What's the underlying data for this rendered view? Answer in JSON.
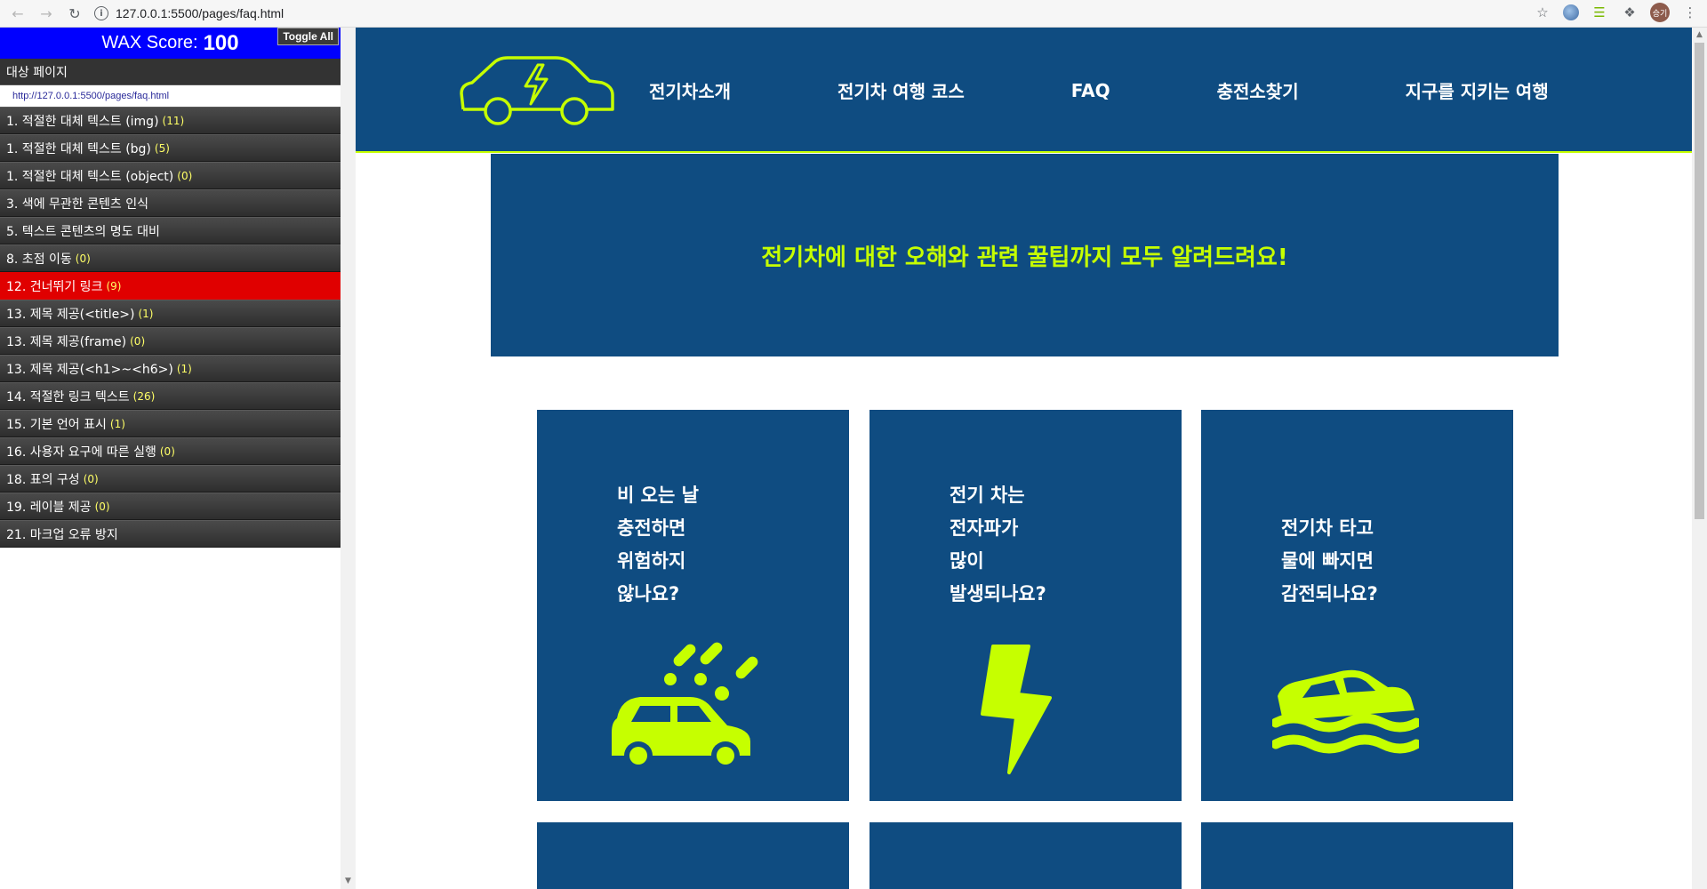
{
  "browser": {
    "url": "127.0.0.1:5500/pages/faq.html",
    "profile_label": "승기"
  },
  "wax": {
    "score_label": "WAX Score:",
    "score_value": "100",
    "toggle_all": "Toggle All",
    "target_label": "대상 페이지",
    "target_url": "http://127.0.0.1:5500/pages/faq.html",
    "items": [
      {
        "label": "1. 적절한 대체 텍스트 (img)",
        "count": "(11)"
      },
      {
        "label": "1. 적절한 대체 텍스트 (bg)",
        "count": "(5)"
      },
      {
        "label": "1. 적절한 대체 텍스트 (object)",
        "count": "(0)"
      },
      {
        "label": "3. 색에 무관한 콘텐츠 인식",
        "count": ""
      },
      {
        "label": "5. 텍스트 콘텐츠의 명도 대비",
        "count": ""
      },
      {
        "label": "8. 초점 이동",
        "count": "(0)"
      },
      {
        "label": "12. 건너뛰기 링크",
        "count": "(9)"
      },
      {
        "label": "13. 제목 제공(<title>)",
        "count": "(1)"
      },
      {
        "label": "13. 제목 제공(frame)",
        "count": "(0)"
      },
      {
        "label": "13. 제목 제공(<h1>~<h6>)",
        "count": "(1)"
      },
      {
        "label": "14. 적절한 링크 텍스트",
        "count": "(26)"
      },
      {
        "label": "15. 기본 언어 표시",
        "count": "(1)"
      },
      {
        "label": "16. 사용자 요구에 따른 실행",
        "count": "(0)"
      },
      {
        "label": "18. 표의 구성",
        "count": "(0)"
      },
      {
        "label": "19. 레이블 제공",
        "count": "(0)"
      },
      {
        "label": "21. 마크업 오류 방지",
        "count": ""
      }
    ],
    "active_index": 6
  },
  "site": {
    "nav": [
      "전기차소개",
      "전기차 여행 코스",
      "FAQ",
      "충전소찾기",
      "지구를 지키는 여행"
    ],
    "banner_title": "전기차에 대한 오해와 관련 꿀팁까지 모두 알려드려요!",
    "cards": [
      {
        "lines": [
          "비 오는 날",
          "충전하면",
          "위험하지",
          "않나요?"
        ],
        "icon": "car-rain-icon"
      },
      {
        "lines": [
          "전기 차는",
          "전자파가",
          "많이",
          "발생되나요?"
        ],
        "icon": "lightning-bolt-icon"
      },
      {
        "lines": [
          "전기차 타고",
          "물에 빠지면",
          "감전되나요?"
        ],
        "icon": "car-flood-icon"
      }
    ]
  },
  "colors": {
    "brand_blue": "#0f4c81",
    "accent_lime": "#c6ff00",
    "wax_blue": "#0000ff",
    "wax_active": "#e00000"
  }
}
